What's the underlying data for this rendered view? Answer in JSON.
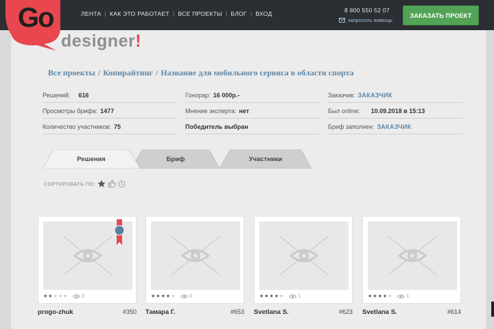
{
  "header": {
    "nav": [
      {
        "label": "ЛЕНТА"
      },
      {
        "label": "КАК ЭТО РАБОТАЕТ"
      },
      {
        "label": "ВСЕ ПРОЕКТЫ"
      },
      {
        "label": "БЛОГ"
      },
      {
        "label": "ВХОД"
      }
    ],
    "phone": "8 800 550 52 07",
    "help_label": "запросить помощь",
    "order_label": "ЗАКАЗАТЬ ПРОЕКТ"
  },
  "logo": {
    "main": "Go",
    "sub": "designer",
    "excl": "!"
  },
  "breadcrumb": {
    "all": "Все проекты",
    "category": "Копирайтинг",
    "title": "Название для мобильного сервиса в области спорта"
  },
  "info": {
    "solutions_label": "Решений:",
    "solutions_value": "616",
    "views_label": "Просмотры брифа:",
    "views_value": "1477",
    "participants_label": "Количество участников:",
    "participants_value": "75",
    "fee_label": "Гонорар:",
    "fee_value": "16 000р.-",
    "expert_label": "Мнение эксперта:",
    "expert_value": "нет",
    "winner_label": "Победитель выбран",
    "client_label": "Заказчик:",
    "client_value": "ЗАКАЗЧИК",
    "online_label": "Был online:",
    "online_value": "10.09.2018 в 15:13",
    "brief_label": "Бриф заполнен:",
    "brief_value": "ЗАКАЗЧИК"
  },
  "tabs": [
    {
      "label": "Решения"
    },
    {
      "label": "Бриф"
    },
    {
      "label": "Участники"
    }
  ],
  "sort_label": "СОРТИРОВАТЬ ПО:",
  "cards": [
    {
      "author": "progo-zhuk",
      "number": "#350",
      "stars": 2,
      "views": "0"
    },
    {
      "author": "Тамара Г.",
      "number": "#653",
      "stars": 4,
      "views": "0"
    },
    {
      "author": "Svetlana S.",
      "number": "#623",
      "stars": 4,
      "views": "1"
    },
    {
      "author": "Svetlana S.",
      "number": "#614",
      "stars": 4,
      "views": "1"
    }
  ],
  "colors": {
    "accent_green": "#53a357",
    "link_blue": "#5b86a8",
    "logo_red": "#e8474f"
  }
}
